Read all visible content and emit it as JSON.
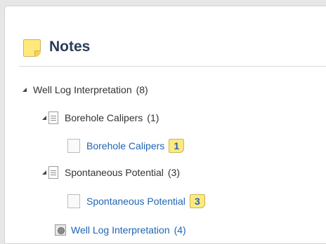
{
  "panel": {
    "title": "Notes",
    "icon": "sticky-note-icon"
  },
  "tree": {
    "root": {
      "label": "Well Log Interpretation",
      "count": "(8)",
      "expanded": true
    },
    "groups": [
      {
        "label": "Borehole Calipers",
        "count": "(1)",
        "icon": "notebook-icon",
        "expanded": true,
        "children": [
          {
            "label": "Borehole Calipers",
            "badge": "1",
            "icon": "page-icon"
          }
        ]
      },
      {
        "label": "Spontaneous Potential",
        "count": "(3)",
        "icon": "notebook-icon",
        "expanded": true,
        "children": [
          {
            "label": "Spontaneous Potential",
            "badge": "3",
            "icon": "page-icon"
          }
        ]
      }
    ],
    "leaf": {
      "label": "Well Log Interpretation",
      "count": "(4)",
      "icon": "gear-document-icon"
    }
  },
  "colors": {
    "title": "#2b3d57",
    "link": "#1f64b4",
    "badge_bg": "#ffe97d"
  }
}
